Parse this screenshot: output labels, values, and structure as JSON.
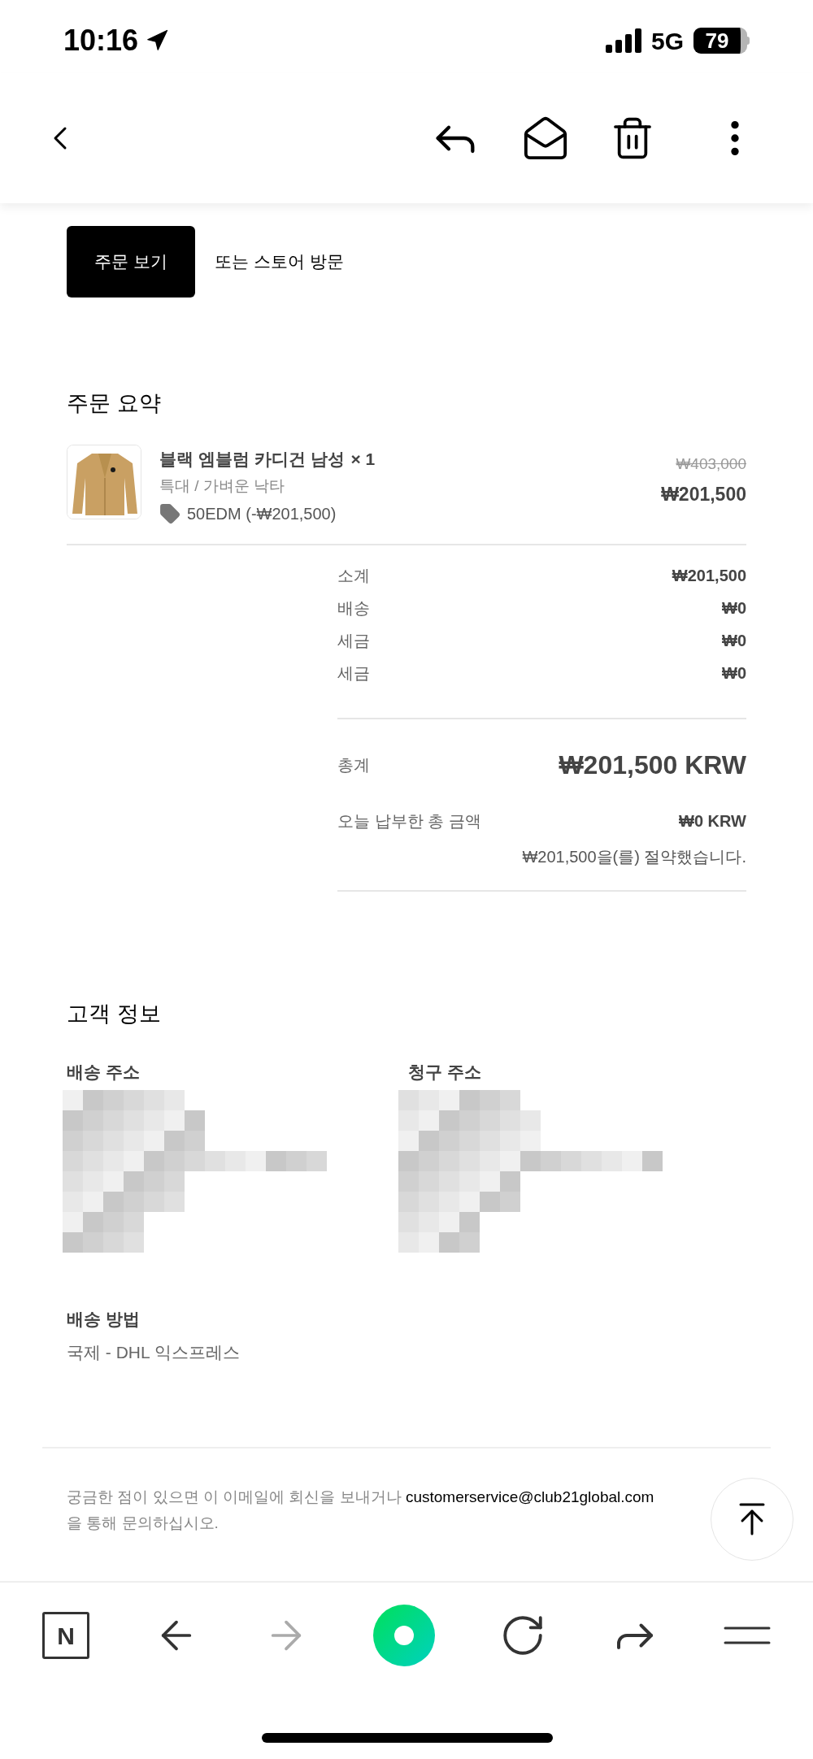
{
  "status_bar": {
    "time": "10:16",
    "network": "5G",
    "battery": "79"
  },
  "actions": {
    "view_order": "주문 보기",
    "store_link": "또는 스토어 방문"
  },
  "order_summary": {
    "title": "주문 요약",
    "items": [
      {
        "name": "블랙 엠블럼 카디건 남성",
        "quantity": "× 1",
        "variant": "특대 / 가벼운 낙타",
        "discount": "50EDM (-₩201,500)",
        "original_price": "₩403,000",
        "price": "₩201,500"
      }
    ],
    "lines": [
      {
        "label": "소계",
        "value": "₩201,500"
      },
      {
        "label": "배송",
        "value": "₩0"
      },
      {
        "label": "세금",
        "value": "₩0"
      },
      {
        "label": "세금",
        "value": "₩0"
      }
    ],
    "total": {
      "label": "총계",
      "value": "₩201,500 KRW"
    },
    "paid_today": {
      "label": "오늘 납부한 총 금액",
      "value": "₩0 KRW"
    },
    "savings": "₩201,500을(를) 절약했습니다."
  },
  "customer_info": {
    "title": "고객 정보",
    "shipping_address_label": "배송 주소",
    "billing_address_label": "청구 주소",
    "shipping_method_label": "배송 방법",
    "shipping_method": "국제 - DHL 익스프레스"
  },
  "footer": {
    "text_before": "궁금한 점이 있으면 이 이메일에 회신을 보내거나 ",
    "email": "customerservice@club21global.com",
    "text_after": "을 통해 문의하십시오."
  },
  "browser_bar": {
    "logo": "N",
    "forward_disabled": true
  }
}
